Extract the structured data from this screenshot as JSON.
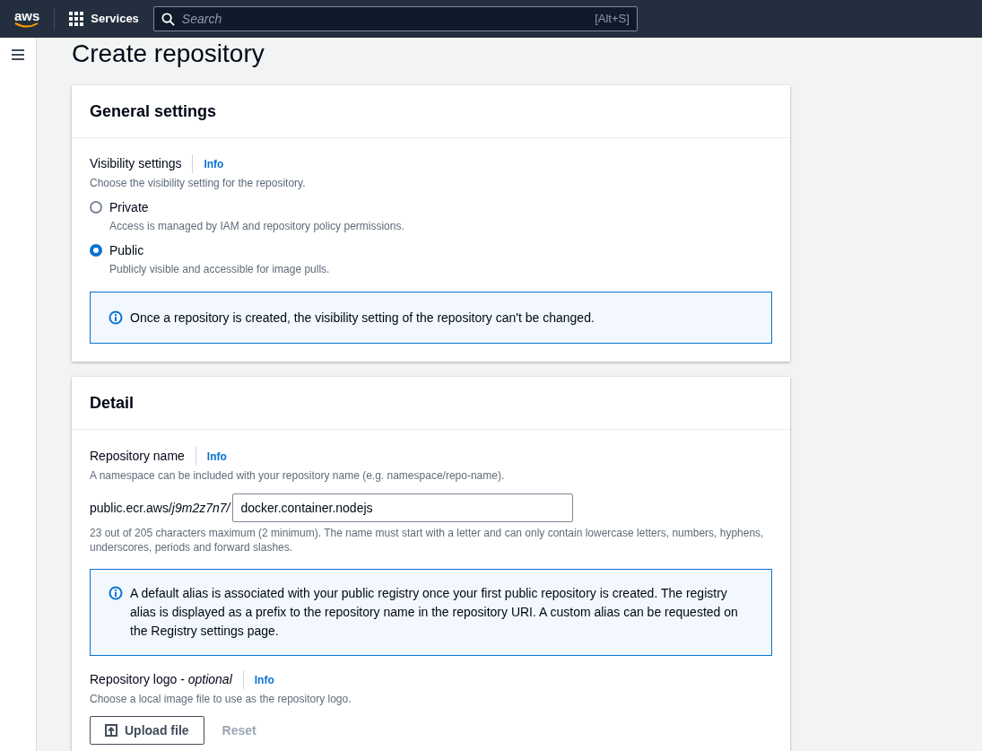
{
  "top_nav": {
    "logo": "aws",
    "services": "Services",
    "search": {
      "placeholder": "Search",
      "shortcut": "[Alt+S]"
    }
  },
  "page_title": "Create repository",
  "general_settings": {
    "heading": "General settings",
    "label": "Visibility settings",
    "info": "Info",
    "description": "Choose the visibility setting for the repository.",
    "options": [
      {
        "label": "Private",
        "description": "Access is managed by IAM and repository policy permissions.",
        "selected": false
      },
      {
        "label": "Public",
        "description": "Publicly visible and accessible for image pulls.",
        "selected": true
      }
    ],
    "alert": "Once a repository is created, the visibility setting of the repository can't be changed."
  },
  "detail": {
    "heading": "Detail",
    "name_label": "Repository name",
    "name_info": "Info",
    "name_description": "A namespace can be included with your repository name (e.g. namespace/repo-name).",
    "prefix": "public.ecr.aws/*j9m2z7n7/*",
    "name_value": "docker.container.nodejs",
    "constraint": "23 out of 205 characters maximum (2 minimum). The name must start with a letter and can only contain lowercase letters, numbers, hyphens, underscores, periods and forward slashes.",
    "alert": "A default alias is associated with your public registry once your first public repository is created. The registry alias is displayed as a prefix to the repository name in the repository URI. A custom alias can be requested on the Registry settings page.",
    "logo_label": "Repository logo - *optional*",
    "logo_info": "Info",
    "logo_description": "Choose a local image file to use as the repository logo.",
    "upload_button": "Upload file",
    "reset_button": {
      "label": "Reset",
      "disabled": true
    }
  }
}
